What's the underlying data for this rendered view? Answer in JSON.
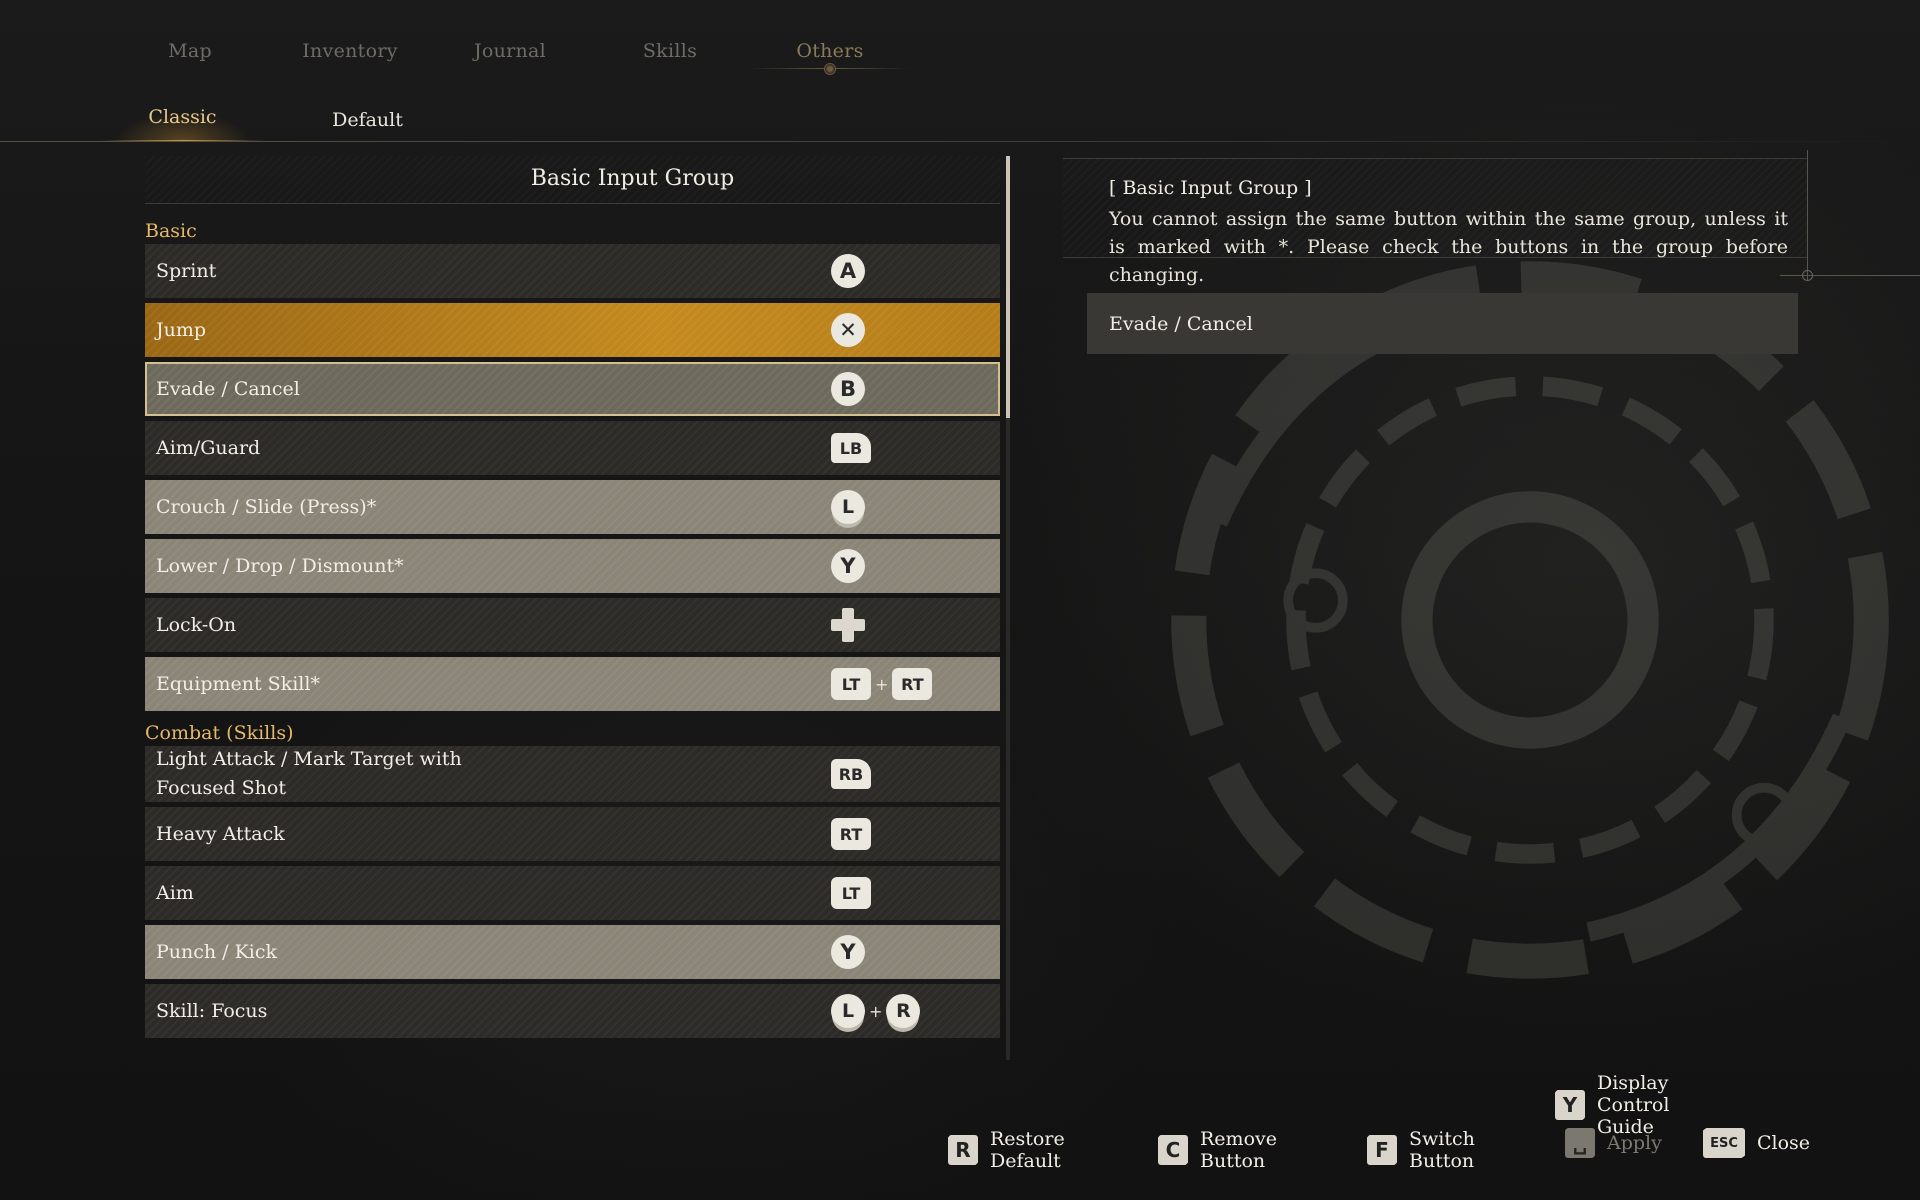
{
  "top_tabs": [
    "Map",
    "Inventory",
    "Journal",
    "Skills",
    "Others"
  ],
  "sub_tabs": [
    "Classic",
    "Default"
  ],
  "group_title": "Basic Input Group",
  "sections": {
    "basic": "Basic",
    "combat": "Combat (Skills)"
  },
  "rows": {
    "sprint": {
      "label": "Sprint",
      "key": "A"
    },
    "jump": {
      "label": "Jump",
      "key": "✕"
    },
    "evade": {
      "label": "Evade / Cancel",
      "key": "B"
    },
    "aim_guard": {
      "label": "Aim/Guard",
      "key": "LB"
    },
    "crouch": {
      "label": "Crouch / Slide (Press)*",
      "key": "L"
    },
    "lower": {
      "label": "Lower / Drop / Dismount*",
      "key": "Y"
    },
    "lock_on": {
      "label": "Lock-On",
      "icon": "dpad-icon"
    },
    "equipment": {
      "label": "Equipment Skill*",
      "key1": "LT",
      "plus": "+",
      "key2": "RT"
    },
    "light_attack": {
      "label_line1": "Light Attack / Mark Target with",
      "label_line2": "Focused Shot",
      "key": "RB"
    },
    "heavy_attack": {
      "label": "Heavy Attack",
      "key": "RT"
    },
    "aim": {
      "label": "Aim",
      "key": "LT"
    },
    "punch": {
      "label": "Punch / Kick",
      "key": "Y"
    },
    "focus": {
      "label": "Skill: Focus",
      "key1": "L",
      "plus": "+",
      "key2": "R"
    }
  },
  "info": {
    "title": "[ Basic Input Group ]",
    "text": "You cannot assign the same button within the same group, unless it is marked with *. Please check the buttons in the group before changing."
  },
  "detail": "Evade / Cancel",
  "footer": {
    "guide": {
      "key": "Y",
      "label": "Display Control Guide"
    },
    "restore": {
      "key": "R",
      "label": "Restore Default"
    },
    "remove": {
      "key": "C",
      "label": "Remove Button"
    },
    "switch": {
      "key": "F",
      "label": "Switch Button"
    },
    "apply": {
      "key": "␣",
      "label": "Apply"
    },
    "close": {
      "key": "ESC",
      "label": "Close"
    }
  },
  "colors": {
    "accent": "#c48a1e",
    "section_label": "#e6b96a",
    "active_tab": "#e6c88a"
  }
}
